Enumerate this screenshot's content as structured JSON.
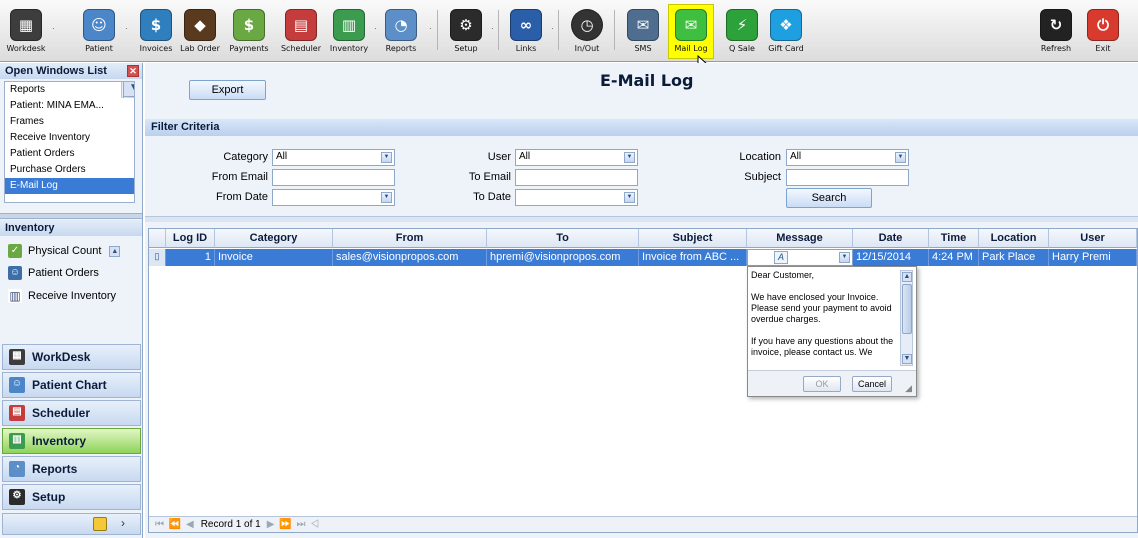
{
  "toolbar": {
    "items": [
      {
        "label": "Workdesk",
        "icon": "workdesk-icon"
      },
      {
        "label": "Patient",
        "icon": "patient-icon"
      },
      {
        "label": "Invoices",
        "icon": "invoices-icon"
      },
      {
        "label": "Lab Order",
        "icon": "lab-order-icon"
      },
      {
        "label": "Payments",
        "icon": "payments-icon"
      },
      {
        "label": "Scheduler",
        "icon": "scheduler-icon"
      },
      {
        "label": "Inventory",
        "icon": "inventory-icon"
      },
      {
        "label": "Reports",
        "icon": "reports-icon"
      },
      {
        "label": "Setup",
        "icon": "setup-icon"
      },
      {
        "label": "Links",
        "icon": "links-icon"
      },
      {
        "label": "In/Out",
        "icon": "clock-icon"
      },
      {
        "label": "SMS",
        "icon": "sms-icon"
      },
      {
        "label": "Mail Log",
        "icon": "mail-icon"
      },
      {
        "label": "Q Sale",
        "icon": "lightning-icon"
      },
      {
        "label": "Gift Card",
        "icon": "gift-icon"
      },
      {
        "label": "Refresh",
        "icon": "refresh-icon"
      },
      {
        "label": "Exit",
        "icon": "power-icon"
      }
    ]
  },
  "open_windows": {
    "title": "Open Windows List",
    "items": [
      "Reports",
      "Patient: MINA EMA...",
      "Frames",
      "Receive Inventory",
      "Patient Orders",
      "Purchase Orders",
      "E-Mail Log"
    ],
    "selected": "E-Mail Log"
  },
  "inventory_panel": {
    "title": "Inventory",
    "items": [
      "Physical Count",
      "Patient Orders",
      "Receive Inventory"
    ]
  },
  "main_nav": {
    "items": [
      "WorkDesk",
      "Patient Chart",
      "Scheduler",
      "Inventory",
      "Reports",
      "Setup"
    ],
    "active": "Inventory"
  },
  "page": {
    "title": "E-Mail Log",
    "export_label": "Export"
  },
  "filter": {
    "title": "Filter Criteria",
    "category_label": "Category",
    "category_value": "All",
    "user_label": "User",
    "user_value": "All",
    "location_label": "Location",
    "location_value": "All",
    "from_email_label": "From Email",
    "from_email_value": "",
    "to_email_label": "To Email",
    "to_email_value": "",
    "subject_label": "Subject",
    "subject_value": "",
    "from_date_label": "From Date",
    "from_date_value": "",
    "to_date_label": "To Date",
    "to_date_value": "",
    "search_label": "Search"
  },
  "grid": {
    "columns": [
      "Log ID",
      "Category",
      "From",
      "To",
      "Subject",
      "Message",
      "Date",
      "Time",
      "Location",
      "User"
    ],
    "rows": [
      {
        "log_id": "1",
        "category": "Invoice",
        "from": "sales@visionpropos.com",
        "to": "hpremi@visionpropos.com",
        "subject": "Invoice from ABC ...",
        "message_icon": "A",
        "date": "12/15/2014",
        "time": "4:24 PM",
        "location": "Park Place",
        "user": "Harry Premi"
      }
    ],
    "pager_text": "Record 1 of 1"
  },
  "message_popup": {
    "paragraphs": [
      "Dear Customer,",
      "We have enclosed your Invoice. Please send your payment to avoid overdue charges.",
      "If you have any questions about the invoice, please contact us. We"
    ],
    "ok_label": "OK",
    "cancel_label": "Cancel"
  },
  "colors": {
    "selection": "#3a7bd5",
    "active_toolbar": "#ffff00",
    "active_nav": "#8fd35a"
  }
}
